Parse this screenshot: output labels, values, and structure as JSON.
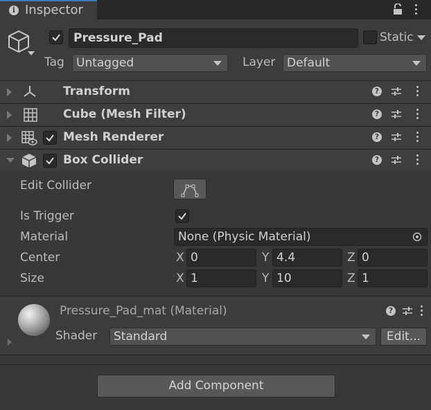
{
  "window": {
    "tab_title": "Inspector"
  },
  "header": {
    "object_name": "Pressure_Pad",
    "static_label": "Static",
    "tag_label": "Tag",
    "tag_value": "Untagged",
    "layer_label": "Layer",
    "layer_value": "Default"
  },
  "components": [
    {
      "name": "Transform"
    },
    {
      "name": "Cube (Mesh Filter)"
    },
    {
      "name": "Mesh Renderer"
    },
    {
      "name": "Box Collider"
    }
  ],
  "box_collider": {
    "edit_collider_label": "Edit Collider",
    "is_trigger_label": "Is Trigger",
    "material_label": "Material",
    "material_value": "None (Physic Material)",
    "center_label": "Center",
    "center": {
      "x_label": "X",
      "x": "0",
      "y_label": "Y",
      "y": "4.4",
      "z_label": "Z",
      "z": "0"
    },
    "size_label": "Size",
    "size": {
      "x_label": "X",
      "x": "1",
      "y_label": "Y",
      "y": "10",
      "z_label": "Z",
      "z": "1"
    }
  },
  "material": {
    "title": "Pressure_Pad_mat (Material)",
    "shader_label": "Shader",
    "shader_value": "Standard",
    "edit_label": "Edit..."
  },
  "footer": {
    "add_component_label": "Add Component"
  },
  "colors": {
    "accent": "#3a79bb",
    "background": "#383838",
    "field": "#2a2a2a"
  }
}
